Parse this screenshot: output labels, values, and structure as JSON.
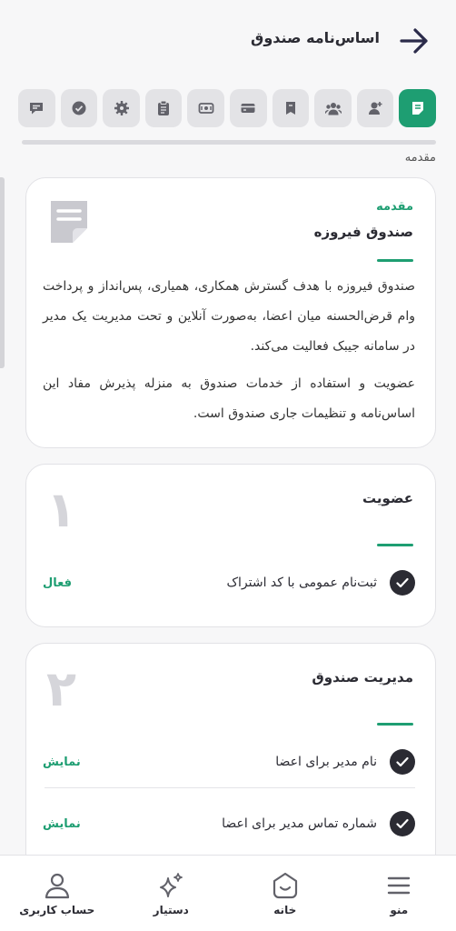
{
  "header": {
    "title": "اساس‌نامه صندوق"
  },
  "tabs": [
    {
      "icon": "document-icon",
      "active": true
    },
    {
      "icon": "add-user-icon"
    },
    {
      "icon": "users-icon"
    },
    {
      "icon": "bookmark-icon"
    },
    {
      "icon": "card-icon"
    },
    {
      "icon": "cash-icon"
    },
    {
      "icon": "clipboard-icon"
    },
    {
      "icon": "gear-icon"
    },
    {
      "icon": "check-circle-icon"
    },
    {
      "icon": "chat-icon"
    }
  ],
  "section_label": "مقدمه",
  "intro": {
    "kicker": "مقدمه",
    "title": "صندوق فیروزه",
    "p1": "صندوق فیروزه با هدف گسترش همکاری، همیاری، پس‌انداز و پرداخت وام قرض‌الحسنه میان اعضا، به‌صورت آنلاین و تحت مدیریت یک مدیر در سامانه جیبک فعالیت می‌کند.",
    "p2": "عضویت و استفاده از خدمات صندوق به منزله پذیرش مفاد این اساس‌نامه و تنظیمات جاری صندوق است."
  },
  "sections": [
    {
      "number": "۱",
      "title": "عضویت",
      "rows": [
        {
          "label": "ثبت‌نام عمومی با کد اشتراک",
          "status": "فعال"
        }
      ]
    },
    {
      "number": "۲",
      "title": "مدیریت صندوق",
      "rows": [
        {
          "label": "نام مدیر برای اعضا",
          "status": "نمایش"
        },
        {
          "label": "شماره تماس مدیر برای اعضا",
          "status": "نمایش"
        }
      ]
    }
  ],
  "nav": {
    "menu": "منو",
    "home": "خانه",
    "assistant": "دستیار",
    "account": "حساب کاربری"
  },
  "colors": {
    "accent": "#1e9e72",
    "dark": "#2b2b33",
    "tab_bg": "#e3e3e6"
  }
}
